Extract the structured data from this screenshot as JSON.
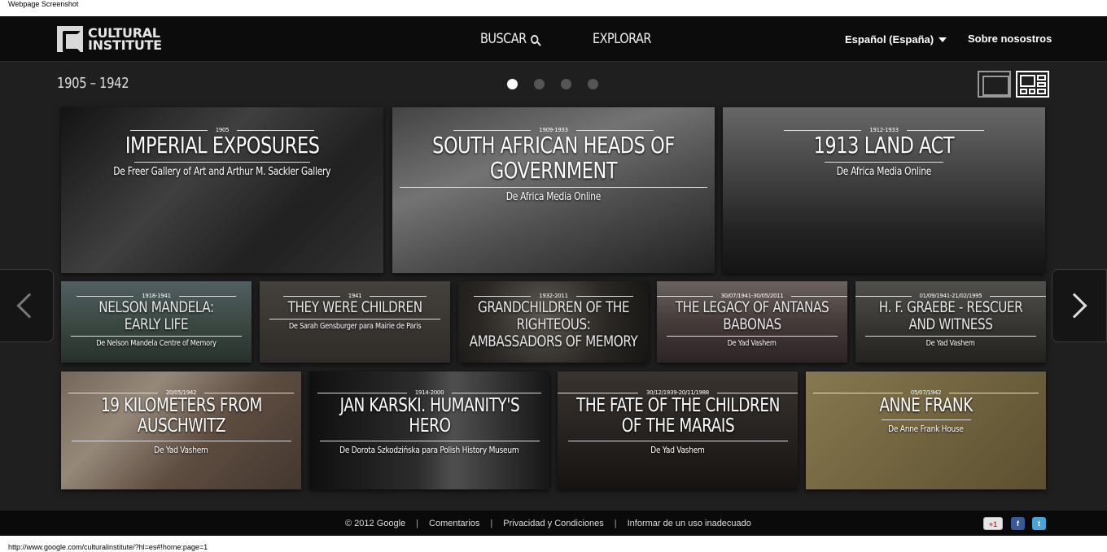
{
  "caption_top": "Webpage Screenshot",
  "caption_url": "http://www.google.com/culturalinstitute/?hl=es#!home:page=1",
  "header": {
    "logo_line1": "CULTURAL",
    "logo_line2": "INSTITUTE",
    "nav_search": "BUSCAR",
    "nav_explore": "EXPLORAR",
    "language": "Español (España)",
    "about": "Sobre nosostros"
  },
  "range_label": "1905 – 1942",
  "pager": {
    "pages": 4,
    "current": 1
  },
  "exhibits": [
    {
      "date": "1905",
      "title": "IMPERIAL EXPOSURES",
      "source": "De Freer Gallery of Art and Arthur M. Sackler Gallery",
      "bg": "#3a3a3a"
    },
    {
      "date": "1909-1933",
      "title": "SOUTH AFRICAN HEADS OF GOVERNMENT",
      "source": "De Africa Media Online",
      "bg": "#6d6d6d"
    },
    {
      "date": "1912-1933",
      "title": "1913 LAND ACT",
      "source": "De Africa Media Online",
      "bg": "#494949"
    },
    {
      "date": "1918-1941",
      "title": "NELSON MANDELA: EARLY LIFE",
      "source": "De Nelson Mandela Centre of Memory",
      "bg": "#4b5a52"
    },
    {
      "date": "1941",
      "title": "THEY WERE CHILDREN",
      "source": "De Sarah Gensburger para Mairie de Paris",
      "bg": "#4c4944"
    },
    {
      "date": "1932-2011",
      "title": "GRANDCHILDREN OF THE RIGHTEOUS: AMBASSADORS OF MEMORY",
      "source": "",
      "bg": "#3c3a36"
    },
    {
      "date": "30/07/1941-30/05/2011",
      "title": "THE LEGACY OF ANTANAS BABONAS",
      "source": "De Yad Vashem",
      "bg": "#5b4e4c"
    },
    {
      "date": "01/09/1941-21/02/1995",
      "title": "H. F. GRAEBE - RESCUER AND WITNESS",
      "source": "De Yad Vashem",
      "bg": "#4a4a46"
    },
    {
      "date": "20/05/1942",
      "title": "19 KILOMETERS FROM AUSCHWITZ",
      "source": "De Yad Vashem",
      "bg": "#7a6555"
    },
    {
      "date": "1914-2000",
      "title": "JAN KARSKI. HUMANITY'S HERO",
      "source": "De Dorota Szkodzińska para Polish History Museum",
      "bg": "#2e2e2e"
    },
    {
      "date": "30/12/1939-20/11/1988",
      "title": "THE FATE OF THE CHILDREN OF THE MARAIS",
      "source": "De Yad Vashem",
      "bg": "#3e3933"
    },
    {
      "date": "05/07/1942",
      "title": "ANNE FRANK",
      "source": "De Anne Frank House",
      "bg": "#8e7f55"
    }
  ],
  "footer": {
    "copyright": "© 2012 Google",
    "comments": "Comentarios",
    "privacy": "Privacidad y Condiciones",
    "report": "Informar de un uso inadecuado",
    "sep": "|",
    "gplus": "+1"
  }
}
